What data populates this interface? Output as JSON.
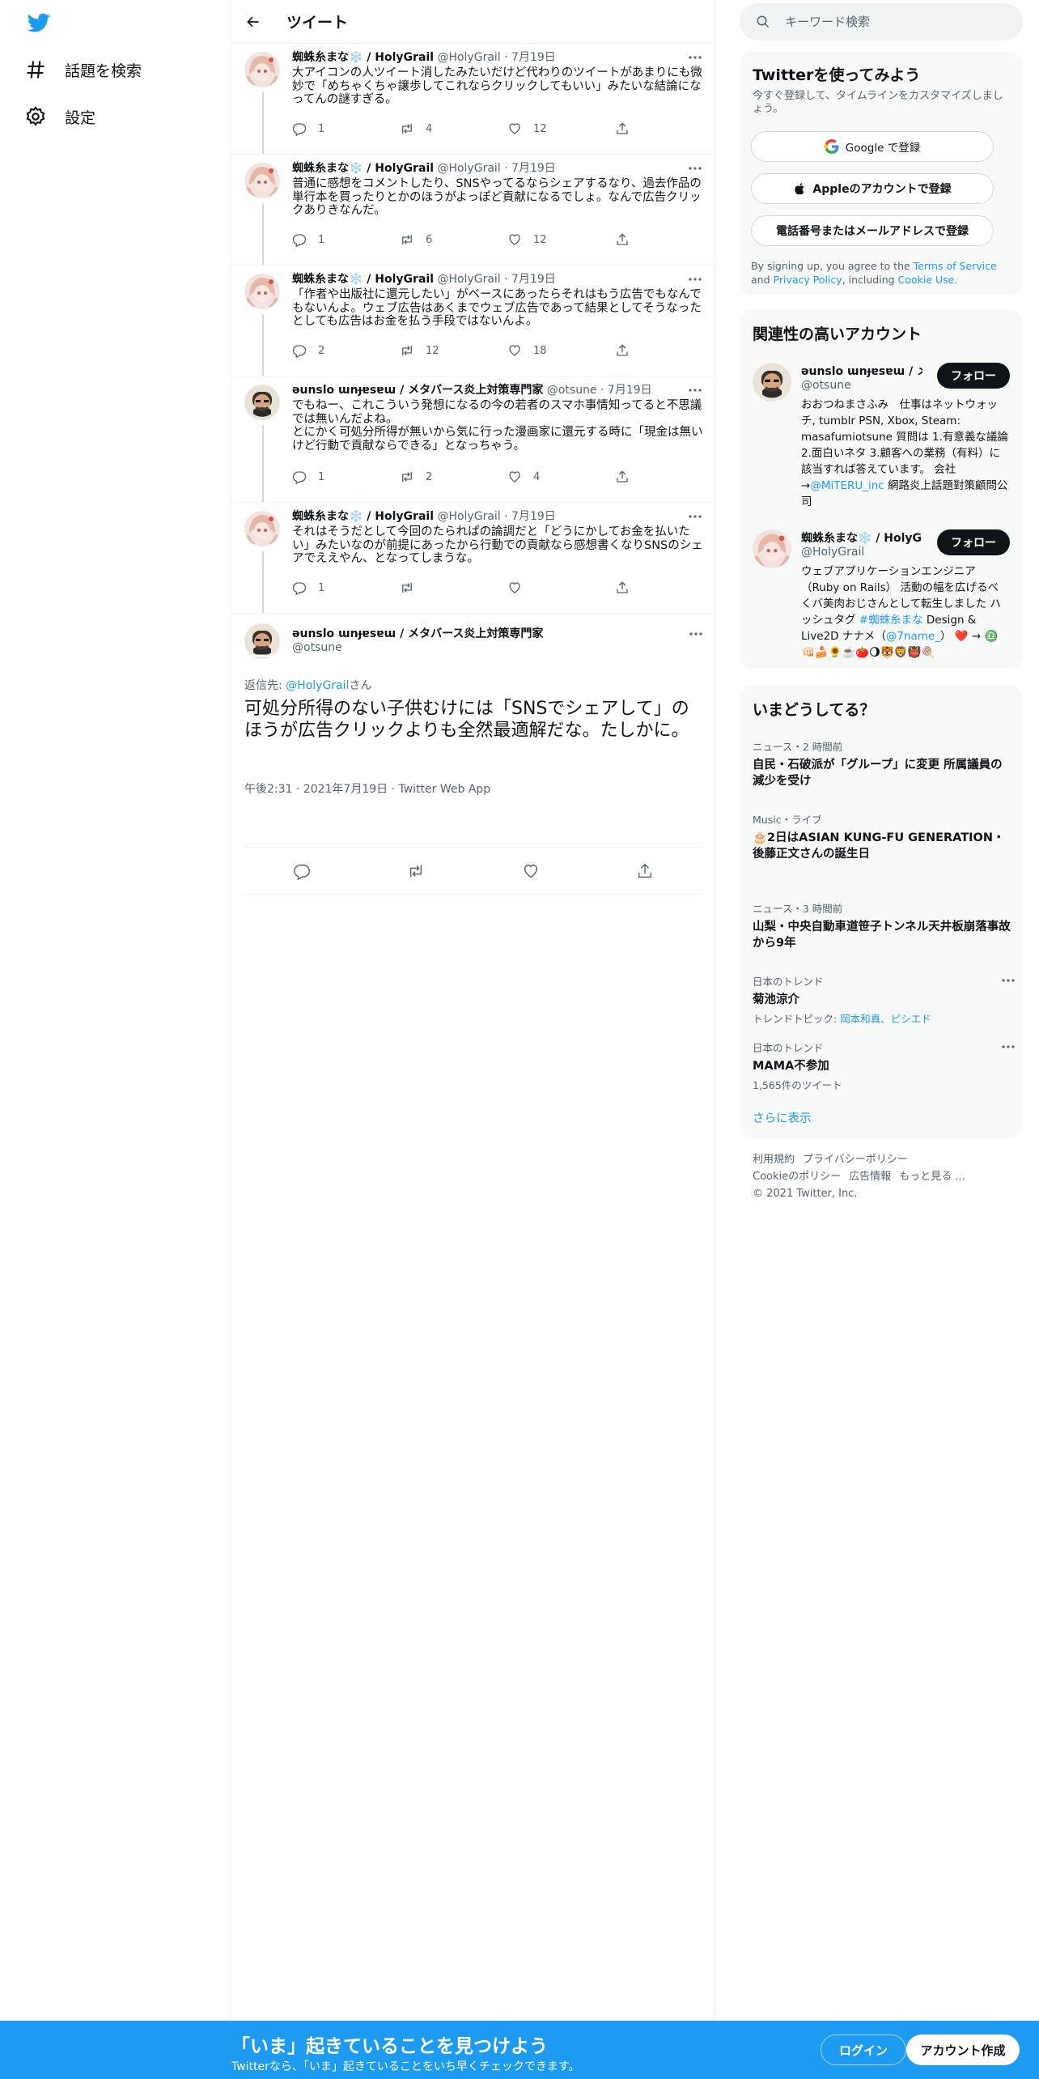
{
  "nav": {
    "logo_icon": "twitter-bird-icon",
    "explore_label": "話題を検索",
    "settings_label": "設定"
  },
  "header": {
    "title": "ツイート"
  },
  "thread": [
    {
      "name": "蜘蛛糸まな❄️ / HolyGrail",
      "handle": "@HolyGrail",
      "date": "· 7月19日",
      "text": "大アイコンの人ツイート消したみたいだけど代わりのツイートがあまりにも微妙で「めちゃくちゃ譲歩してこれならクリックしてもいい」みたいな結論になってんの謎すぎる。",
      "replies": "1",
      "retweets": "4",
      "likes": "12"
    },
    {
      "name": "蜘蛛糸まな❄️ / HolyGrail",
      "handle": "@HolyGrail",
      "date": "· 7月19日",
      "text": "普通に感想をコメントしたり、SNSやってるならシェアするなり、過去作品の単行本を買ったりとかのほうがよっぽど貢献になるでしょ。なんで広告クリックありきなんだ。",
      "replies": "1",
      "retweets": "6",
      "likes": "12"
    },
    {
      "name": "蜘蛛糸まな❄️ / HolyGrail",
      "handle": "@HolyGrail",
      "date": "· 7月19日",
      "text": "「作者や出版社に還元したい」がベースにあったらそれはもう広告でもなんでもないんよ。ウェブ広告はあくまでウェブ広告であって結果としてそうなったとしても広告はお金を払う手段ではないんよ。",
      "replies": "2",
      "retweets": "12",
      "likes": "18"
    },
    {
      "name": "ǝunslo ɯnɟɐsɐɯ / メタバース炎上対策専門家",
      "handle": "@otsune",
      "date": "· 7月19日",
      "text": "でもねー、これこういう発想になるの今の若者のスマホ事情知ってると不思議では無いんだよね。\nとにかく可処分所得が無いから気に行った漫画家に還元する時に「現金は無いけど行動で貢献ならできる」となっちゃう。",
      "replies": "1",
      "retweets": "2",
      "likes": "4"
    },
    {
      "name": "蜘蛛糸まな❄️ / HolyGrail",
      "handle": "@HolyGrail",
      "date": "· 7月19日",
      "text": "それはそうだとして今回のたられぱの論調だと「どうにかしてお金を払いたい」みたいなのが前提にあったから行動での貢献なら感想書くなりSNSのシェアでええやん、となってしまうな。",
      "replies": "1",
      "retweets": "",
      "likes": ""
    }
  ],
  "focus": {
    "name": "ǝunslo ɯnɟɐsɐɯ / メタバース炎上対策専門家",
    "handle": "@otsune",
    "reply_prefix": "返信先: ",
    "reply_to": "@HolyGrail",
    "reply_suffix": "さん",
    "text": "可処分所得のない子供むけには「SNSでシェアして」のほうが広告クリックよりも全然最適解だな。たしかに。",
    "meta": "午後2:31 · 2021年7月19日 · Twitter Web App"
  },
  "search": {
    "placeholder": "キーワード検索"
  },
  "signup": {
    "title": "Twitterを使ってみよう",
    "subtitle": "今すぐ登録して、タイムラインをカスタマイズしましょう。",
    "google_label": "Google で登録",
    "apple_label": "Appleのアカウントで登録",
    "phone_label": "電話番号またはメールアドレスで登録",
    "legal_prefix": "By signing up, you agree to the ",
    "legal_terms": "Terms of Service",
    "legal_and": " and ",
    "legal_privacy": "Privacy Policy",
    "legal_including": ", including ",
    "legal_cookie": "Cookie Use."
  },
  "related": {
    "title": "関連性の高いアカウント",
    "accounts": [
      {
        "name": "ǝunslo ɯnɟɐsɐɯ / メタバース炎上対策専門家",
        "handle": "@otsune",
        "bio_a": "おおつねまさふみ　仕事はネットウォッチ, tumblr PSN, Xbox, Steam: masafumiotsune 質問は 1.有意義な議論 2.面白いネタ 3.顧客への業務（有料）に該当すれば答えています。 会社→",
        "bio_link": "@MiTERU_inc",
        "bio_b": " 網路炎上話題對策顧問公司",
        "follow": "フォロー"
      },
      {
        "name": "蜘蛛糸まな❄️ / HolyGrail",
        "handle": "@HolyGrail",
        "bio_a": "ウェブアプリケーションエンジニア（Ruby on Rails） 活動の幅を広げるべくバ美肉おじさんとして転生しました ハッシュタグ ",
        "bio_link": "#蜘蛛糸まな",
        "bio_b": " Design & Live2D ナナメ（",
        "bio_link2": "@7name_",
        "bio_c": "） ❤️ → ♎️👊🏻🍰🌻☕️🍅🌖🐯🦁👹🍭",
        "follow": "フォロー"
      }
    ]
  },
  "trends": {
    "title": "いまどうしてる？",
    "items": [
      {
        "context": "ニュース・2 時間前",
        "title": "自民・石破派が「グループ」に変更 所属議員の減少を受け",
        "sub": ""
      },
      {
        "context": "Music・ライブ",
        "title": "🎂2日はASIAN KUNG-FU GENERATION・後藤正文さんの誕生日",
        "sub": ""
      },
      {
        "context": "ニュース・3 時間前",
        "title": "山梨・中央自動車道笹子トンネル天井板崩落事故から9年",
        "sub": ""
      },
      {
        "context": "日本のトレンド",
        "title": "菊池涼介",
        "sub_prefix": "トレンドトピック: ",
        "sub_links": "岡本和真、ピシエド"
      },
      {
        "context": "日本のトレンド",
        "title": "MAMA不参加",
        "sub": "1,565件のツイート"
      }
    ],
    "show_more": "さらに表示"
  },
  "footer": {
    "links_row1": [
      "利用規約",
      "プライバシーポリシー"
    ],
    "links_row2": [
      "Cookieのポリシー",
      "広告情報",
      "もっと見る ..."
    ],
    "copyright": "© 2021 Twitter, Inc."
  },
  "bottombar": {
    "headline": "「いま」起きていることを見つけよう",
    "subline": "Twitterなら、「いま」起きていることをいち早くチェックできます。",
    "login": "ログイン",
    "signup": "アカウント作成"
  },
  "colors": {
    "accent": "#1d9bf0",
    "text": "#0f1419",
    "muted": "#536471"
  }
}
